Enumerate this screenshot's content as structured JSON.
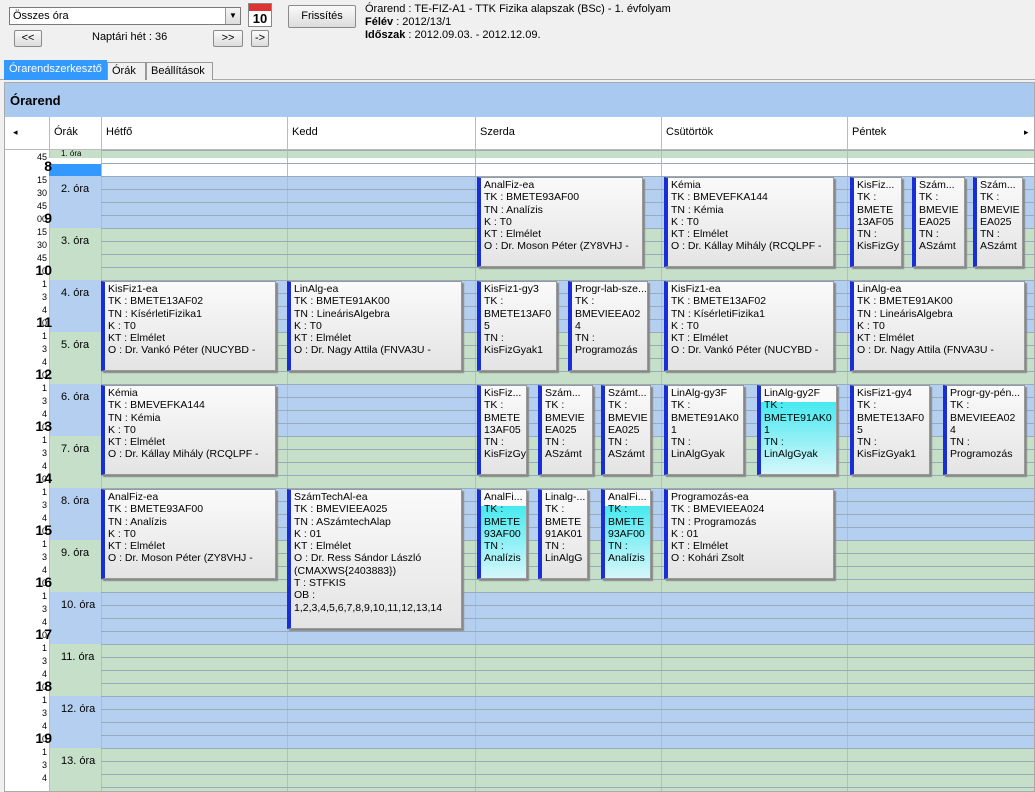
{
  "toolbar": {
    "view_select": "Összes óra",
    "calendar_day": "10",
    "refresh_label": "Frissítés",
    "prev_label": "<<",
    "next_label": ">>",
    "go_label": "->",
    "week_label": "Naptári hét : 36"
  },
  "info": {
    "line1": "Órarend : TE-FIZ-A1 - TTK Fizika alapszak (BSc) - 1. évfolyam",
    "semester_label": "Félév",
    "semester_value": " : 2012/13/1",
    "period_label": "Időszak",
    "period_value": " : 2012.09.03. - 2012.12.09."
  },
  "tabs": [
    "Órarendszerkesztő",
    "Órák",
    "Beállítások"
  ],
  "panel_title": "Órarend",
  "columns": {
    "hours": "Órák",
    "days": [
      "Hétfő",
      "Kedd",
      "Szerda",
      "Csütörtök",
      "Péntek"
    ]
  },
  "hours": [
    "8",
    "9",
    "10",
    "11",
    "12",
    "13",
    "14",
    "15",
    "16",
    "17",
    "18",
    "19"
  ],
  "ticks": [
    "45",
    "00",
    "15",
    "30",
    "45",
    "00",
    "15",
    "30",
    "45"
  ],
  "ora_labels": [
    "1. óra",
    "2. óra",
    "3. óra",
    "4. óra",
    "5. óra",
    "6. óra",
    "7. óra",
    "8. óra",
    "9. óra",
    "10. óra",
    "11. óra",
    "12. óra",
    "13. óra"
  ],
  "events": [
    {
      "lines": [
        "AnalFiz-ea",
        "TK : BMETE93AF00",
        "TN : Analízis",
        "K : T0",
        "KT : Elmélet",
        "O : Dr. Moson Péter (ZY8VHJ -"
      ]
    },
    {
      "lines": [
        "Kémia",
        "TK : BMEVEFKA144",
        "TN : Kémia",
        "K : T0",
        "KT : Elmélet",
        "O : Dr. Kállay Mihály (RCQLPF -"
      ]
    },
    {
      "lines": [
        "KisFiz...",
        "TK :",
        "BMETE",
        "13AF05",
        "TN :",
        "KisFizGy"
      ]
    },
    {
      "lines": [
        "Szám...",
        "TK :",
        "BMEVIE",
        "EA025",
        "TN :",
        "ASzámt"
      ]
    },
    {
      "lines": [
        "Szám...",
        "TK :",
        "BMEVIE",
        "EA025",
        "TN :",
        "ASzámt"
      ]
    },
    {
      "lines": [
        "KisFiz1-ea",
        "TK : BMETE13AF02",
        "TN : KísérletiFizika1",
        "K : T0",
        "KT : Elmélet",
        "O : Dr. Vankó Péter (NUCYBD -"
      ]
    },
    {
      "lines": [
        "LinAlg-ea",
        "TK : BMETE91AK00",
        "TN : LineárisAlgebra",
        "K : T0",
        "KT : Elmélet",
        "O : Dr. Nagy Attila (FNVA3U -"
      ]
    },
    {
      "lines": [
        "KisFiz1-gy3",
        "TK :",
        "BMETE13AF0",
        "5",
        "TN :",
        "KisFizGyak1"
      ]
    },
    {
      "lines": [
        "Progr-lab-sze...",
        "TK :",
        "BMEVIEEA02",
        "4",
        "TN :",
        "Programozás"
      ]
    },
    {
      "lines": [
        "KisFiz1-ea",
        "TK : BMETE13AF02",
        "TN : KísérletiFizika1",
        "K : T0",
        "KT : Elmélet",
        "O : Dr. Vankó Péter (NUCYBD -"
      ]
    },
    {
      "lines": [
        "LinAlg-ea",
        "TK : BMETE91AK00",
        "TN : LineárisAlgebra",
        "K : T0",
        "KT : Elmélet",
        "O : Dr. Nagy Attila (FNVA3U -"
      ]
    },
    {
      "lines": [
        "Kémia",
        "TK : BMEVEFKA144",
        "TN : Kémia",
        "K : T0",
        "KT : Elmélet",
        "O : Dr. Kállay Mihály (RCQLPF -"
      ]
    },
    {
      "lines": [
        "KisFiz...",
        "TK :",
        "BMETE",
        "13AF05",
        "TN :",
        "KisFizGy"
      ]
    },
    {
      "lines": [
        "Szám...",
        "TK :",
        "BMEVIE",
        "EA025",
        "TN :",
        "ASzámt"
      ]
    },
    {
      "lines": [
        "Számt...",
        "TK :",
        "BMEVIE",
        "EA025",
        "TN :",
        "ASzámt"
      ]
    },
    {
      "lines": [
        "LinAlg-gy3F",
        "TK :",
        "BMETE91AK0",
        "1",
        "TN :",
        "LinAlgGyak"
      ]
    },
    {
      "lines": [
        "LinAlg-gy2F",
        "TK :",
        "BMETE91AK0",
        "1",
        "TN :",
        "LinAlgGyak"
      ]
    },
    {
      "lines": [
        "KisFiz1-gy4",
        "TK :",
        "BMETE13AF0",
        "5",
        "TN :",
        "KisFizGyak1"
      ]
    },
    {
      "lines": [
        "Progr-gy-pén...",
        "TK :",
        "BMEVIEEA02",
        "4",
        "TN :",
        "Programozás"
      ]
    },
    {
      "lines": [
        "AnalFiz-ea",
        "TK : BMETE93AF00",
        "TN : Analízis",
        "K : T0",
        "KT : Elmélet",
        "O : Dr. Moson Péter (ZY8VHJ -"
      ]
    },
    {
      "lines": [
        "SzámTechAl-ea",
        "TK : BMEVIEEA025",
        "TN : ASzámtechAlap",
        "K : 01",
        "KT : Elmélet",
        "O : Dr. Ress Sándor László",
        "(CMAXWS{2403883})",
        "T : STFKIS",
        "OB :",
        "1,2,3,4,5,6,7,8,9,10,11,12,13,14"
      ]
    },
    {
      "lines": [
        "AnalFi...",
        "TK :",
        "BMETE",
        "93AF00",
        "TN :",
        "Analízis"
      ]
    },
    {
      "lines": [
        "Linalg-...",
        "TK :",
        "BMETE",
        "91AK01",
        "TN :",
        "LinAlgG"
      ]
    },
    {
      "lines": [
        "AnalFi...",
        "TK :",
        "BMETE",
        "93AF00",
        "TN :",
        "Analízis"
      ]
    },
    {
      "lines": [
        "Programozás-ea",
        "TK : BMEVIEEA024",
        "TN : Programozás",
        "K : 01",
        "KT : Elmélet",
        "O : Kohári Zsolt"
      ]
    }
  ],
  "colors": {
    "blue_band": "#b4cff0",
    "green_band": "#c5dfc8",
    "event_border": "#1a2ed6",
    "highlight": "#47e9f0"
  }
}
